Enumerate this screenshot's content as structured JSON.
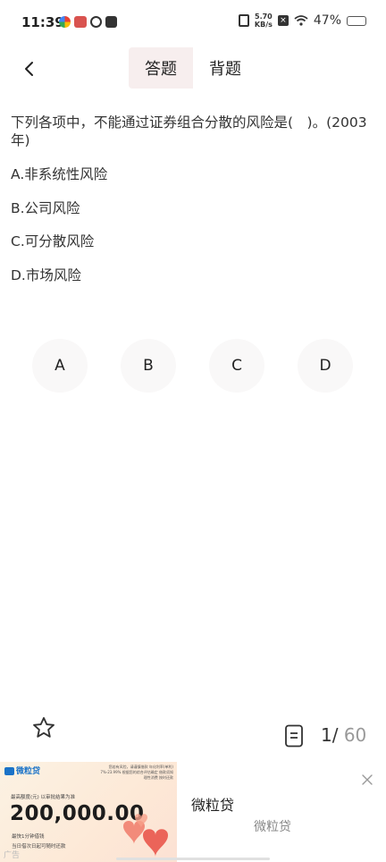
{
  "status_bar": {
    "time": "11:39",
    "net_speed_value": "5.70",
    "net_speed_unit": "KB/s",
    "battery_percent": "47%"
  },
  "tabs": [
    {
      "label": "答题",
      "active": true
    },
    {
      "label": "背题",
      "active": false
    }
  ],
  "question": {
    "text": "下列各项中，不能通过证券组合分散的风险是(　)。(2003年)",
    "options": [
      "A.非系统性风险",
      "B.公司风险",
      "C.可分散风险",
      "D.市场风险"
    ]
  },
  "answer_buttons": [
    "A",
    "B",
    "C",
    "D"
  ],
  "pagination": {
    "current": "1/",
    "total": "60"
  },
  "ad": {
    "logo_text": "微粒贷",
    "fine_print": "您若有风险，请谨慎借款 年化利率(单利) 7%-23.99% 根据您的综合评估确定 借款须知 理性消费 按时还款",
    "caption": "最高额度(元) 以审批结果为准",
    "amount": "200,000.00",
    "line1": "最快1分钟借钱",
    "line2": "当日借次日起可随时还款",
    "tag": "广告",
    "title": "微粒贷",
    "subtitle": "微粒贷"
  },
  "colors": {
    "tab_active_bg": "#f7eeee",
    "answer_button_bg": "#f9f8f8",
    "page_total": "#999999"
  },
  "icons": [
    "back-arrow-icon",
    "star-icon",
    "answer-card-icon",
    "close-icon"
  ]
}
